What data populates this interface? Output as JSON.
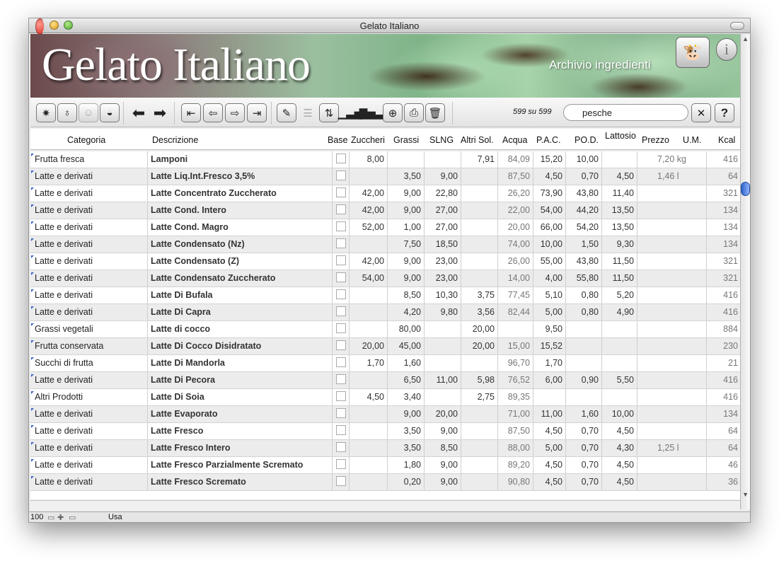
{
  "window": {
    "title": "Gelato Italiano"
  },
  "banner": {
    "logo": "Gelato Italiano",
    "subtitle": "Archivio ingredienti",
    "mascot_icon": "cow-icon",
    "info_icon": "info-icon"
  },
  "toolbar": {
    "counter": "599 su 599",
    "search_value": "pesche",
    "search_icon": "magnifier-icon"
  },
  "columns": [
    "Categoria",
    "Descrizione",
    "Base",
    "Zuccheri",
    "Grassi",
    "SLNG",
    "Altri Sol.",
    "Acqua",
    "P.A.C.",
    "PO.D.",
    "Lattosio",
    "Prezzo",
    "U.M.",
    "Kcal"
  ],
  "rows": [
    {
      "categoria": "Frutta fresca",
      "descrizione": "Lamponi",
      "zuccheri": "8,00",
      "grassi": "",
      "slng": "",
      "altri": "7,91",
      "acqua": "84,09",
      "pac": "15,20",
      "pod": "10,00",
      "lattosio": "",
      "prezzo": "7,20 kg",
      "kcal": "416"
    },
    {
      "categoria": "Latte e derivati",
      "descrizione": "Latte  Liq.Int.Fresco 3,5%",
      "zuccheri": "",
      "grassi": "3,50",
      "slng": "9,00",
      "altri": "",
      "acqua": "87,50",
      "pac": "4,50",
      "pod": "0,70",
      "lattosio": "4,50",
      "prezzo": "1,46 l",
      "kcal": "64"
    },
    {
      "categoria": "Latte e derivati",
      "descrizione": "Latte Concentrato Zuccherato",
      "zuccheri": "42,00",
      "grassi": "9,00",
      "slng": "22,80",
      "altri": "",
      "acqua": "26,20",
      "pac": "73,90",
      "pod": "43,80",
      "lattosio": "11,40",
      "prezzo": "",
      "kcal": "321"
    },
    {
      "categoria": "Latte e derivati",
      "descrizione": "Latte Cond. Intero",
      "zuccheri": "42,00",
      "grassi": "9,00",
      "slng": "27,00",
      "altri": "",
      "acqua": "22,00",
      "pac": "54,00",
      "pod": "44,20",
      "lattosio": "13,50",
      "prezzo": "",
      "kcal": "134"
    },
    {
      "categoria": "Latte e derivati",
      "descrizione": "Latte Cond. Magro",
      "zuccheri": "52,00",
      "grassi": "1,00",
      "slng": "27,00",
      "altri": "",
      "acqua": "20,00",
      "pac": "66,00",
      "pod": "54,20",
      "lattosio": "13,50",
      "prezzo": "",
      "kcal": "134"
    },
    {
      "categoria": "Latte e derivati",
      "descrizione": "Latte Condensato  (Nz)",
      "zuccheri": "",
      "grassi": "7,50",
      "slng": "18,50",
      "altri": "",
      "acqua": "74,00",
      "pac": "10,00",
      "pod": "1,50",
      "lattosio": "9,30",
      "prezzo": "",
      "kcal": "134"
    },
    {
      "categoria": "Latte e derivati",
      "descrizione": "Latte Condensato  (Z)",
      "zuccheri": "42,00",
      "grassi": "9,00",
      "slng": "23,00",
      "altri": "",
      "acqua": "26,00",
      "pac": "55,00",
      "pod": "43,80",
      "lattosio": "11,50",
      "prezzo": "",
      "kcal": "321"
    },
    {
      "categoria": "Latte e derivati",
      "descrizione": "Latte Condensato Zuccherato",
      "zuccheri": "54,00",
      "grassi": "9,00",
      "slng": "23,00",
      "altri": "",
      "acqua": "14,00",
      "pac": "4,00",
      "pod": "55,80",
      "lattosio": "11,50",
      "prezzo": "",
      "kcal": "321"
    },
    {
      "categoria": "Latte e derivati",
      "descrizione": "Latte Di Bufala",
      "zuccheri": "",
      "grassi": "8,50",
      "slng": "10,30",
      "altri": "3,75",
      "acqua": "77,45",
      "pac": "5,10",
      "pod": "0,80",
      "lattosio": "5,20",
      "prezzo": "",
      "kcal": "416"
    },
    {
      "categoria": "Latte e derivati",
      "descrizione": "Latte Di Capra",
      "zuccheri": "",
      "grassi": "4,20",
      "slng": "9,80",
      "altri": "3,56",
      "acqua": "82,44",
      "pac": "5,00",
      "pod": "0,80",
      "lattosio": "4,90",
      "prezzo": "",
      "kcal": "416"
    },
    {
      "categoria": "Grassi vegetali",
      "descrizione": "Latte di cocco",
      "zuccheri": "",
      "grassi": "80,00",
      "slng": "",
      "altri": "20,00",
      "acqua": "",
      "pac": "9,50",
      "pod": "",
      "lattosio": "",
      "prezzo": "",
      "kcal": "884"
    },
    {
      "categoria": "Frutta conservata",
      "descrizione": "Latte Di Cocco Disidratato",
      "zuccheri": "20,00",
      "grassi": "45,00",
      "slng": "",
      "altri": "20,00",
      "acqua": "15,00",
      "pac": "15,52",
      "pod": "",
      "lattosio": "",
      "prezzo": "",
      "kcal": "230"
    },
    {
      "categoria": "Succhi di frutta",
      "descrizione": "Latte Di Mandorla",
      "zuccheri": "1,70",
      "grassi": "1,60",
      "slng": "",
      "altri": "",
      "acqua": "96,70",
      "pac": "1,70",
      "pod": "",
      "lattosio": "",
      "prezzo": "",
      "kcal": "21"
    },
    {
      "categoria": "Latte e derivati",
      "descrizione": "Latte Di Pecora",
      "zuccheri": "",
      "grassi": "6,50",
      "slng": "11,00",
      "altri": "5,98",
      "acqua": "76,52",
      "pac": "6,00",
      "pod": "0,90",
      "lattosio": "5,50",
      "prezzo": "",
      "kcal": "416"
    },
    {
      "categoria": "Altri Prodotti",
      "descrizione": "Latte Di Soia",
      "zuccheri": "4,50",
      "grassi": "3,40",
      "slng": "",
      "altri": "2,75",
      "acqua": "89,35",
      "pac": "",
      "pod": "",
      "lattosio": "",
      "prezzo": "",
      "kcal": "416"
    },
    {
      "categoria": "Latte e derivati",
      "descrizione": "Latte Evaporato",
      "zuccheri": "",
      "grassi": "9,00",
      "slng": "20,00",
      "altri": "",
      "acqua": "71,00",
      "pac": "11,00",
      "pod": "1,60",
      "lattosio": "10,00",
      "prezzo": "",
      "kcal": "134"
    },
    {
      "categoria": "Latte e derivati",
      "descrizione": "Latte Fresco",
      "zuccheri": "",
      "grassi": "3,50",
      "slng": "9,00",
      "altri": "",
      "acqua": "87,50",
      "pac": "4,50",
      "pod": "0,70",
      "lattosio": "4,50",
      "prezzo": "",
      "kcal": "64"
    },
    {
      "categoria": "Latte e derivati",
      "descrizione": "Latte Fresco Intero",
      "zuccheri": "",
      "grassi": "3,50",
      "slng": "8,50",
      "altri": "",
      "acqua": "88,00",
      "pac": "5,00",
      "pod": "0,70",
      "lattosio": "4,30",
      "prezzo": "1,25 l",
      "kcal": "64"
    },
    {
      "categoria": "Latte e derivati",
      "descrizione": "Latte Fresco Parzialmente Scremato",
      "zuccheri": "",
      "grassi": "1,80",
      "slng": "9,00",
      "altri": "",
      "acqua": "89,20",
      "pac": "4,50",
      "pod": "0,70",
      "lattosio": "4,50",
      "prezzo": "",
      "kcal": "46"
    },
    {
      "categoria": "Latte e derivati",
      "descrizione": "Latte Fresco Scremato",
      "zuccheri": "",
      "grassi": "0,20",
      "slng": "9,00",
      "altri": "",
      "acqua": "90,80",
      "pac": "4,50",
      "pod": "0,70",
      "lattosio": "4,50",
      "prezzo": "",
      "kcal": "36"
    }
  ],
  "status": {
    "zoom": "100",
    "mode": "Usa"
  }
}
